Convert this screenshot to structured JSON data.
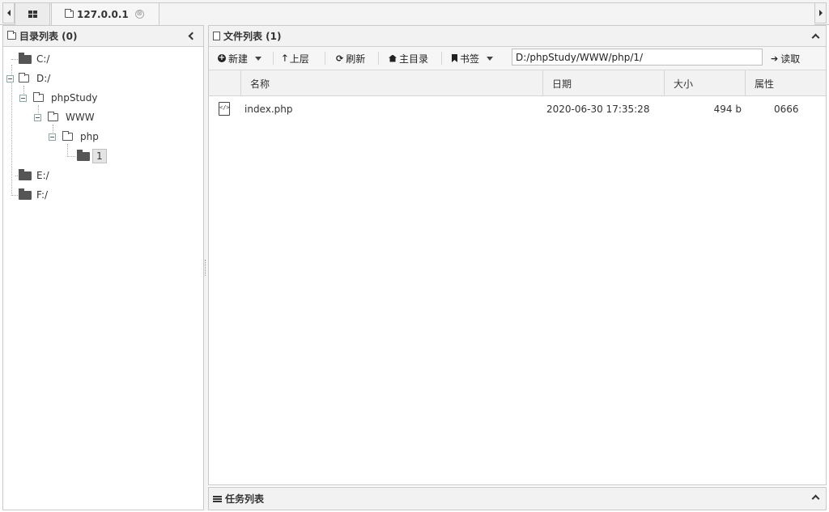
{
  "tabs": [
    {
      "icon": "grid-icon",
      "label": ""
    },
    {
      "icon": "folder-icon",
      "label": "127.0.0.1",
      "close": "⊗"
    }
  ],
  "left_panel": {
    "title": "目录列表 (0)",
    "tree": [
      {
        "label": "C:/",
        "depth": 0,
        "icon": "folder-solid",
        "expanded": false
      },
      {
        "label": "D:/",
        "depth": 0,
        "icon": "folder-outline",
        "expanded": true
      },
      {
        "label": "phpStudy",
        "depth": 1,
        "icon": "folder-outline",
        "expanded": true
      },
      {
        "label": "WWW",
        "depth": 2,
        "icon": "folder-outline",
        "expanded": true
      },
      {
        "label": "php",
        "depth": 3,
        "icon": "folder-outline",
        "expanded": true
      },
      {
        "label": "1",
        "depth": 4,
        "icon": "folder-solid",
        "selected": true
      },
      {
        "label": "E:/",
        "depth": 0,
        "icon": "folder-solid",
        "expanded": false
      },
      {
        "label": "F:/",
        "depth": 0,
        "icon": "folder-solid",
        "expanded": false
      }
    ]
  },
  "right_panel": {
    "title": "文件列表 (1)",
    "toolbar": {
      "new_label": "新建",
      "up_label": "上层",
      "refresh_label": "刷新",
      "home_label": "主目录",
      "bookmark_label": "书签",
      "path_value": "D:/phpStudy/WWW/php/1/",
      "read_label": "读取"
    },
    "columns": [
      "名称",
      "日期",
      "大小",
      "属性"
    ],
    "files": [
      {
        "name": "index.php",
        "date": "2020-06-30 17:35:28",
        "size": "494 b",
        "attr": "0666"
      }
    ]
  },
  "task_panel": {
    "title": "任务列表"
  },
  "colors": {
    "panel_header": "#f2f2f2",
    "border": "#c9c9c9",
    "text": "#333333"
  }
}
